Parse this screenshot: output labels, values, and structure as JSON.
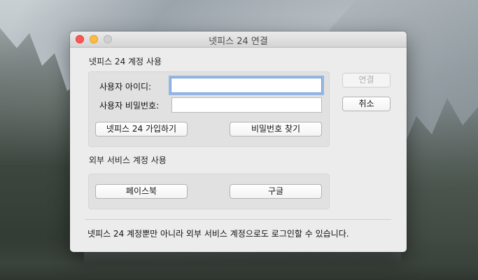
{
  "window": {
    "title": "넷피스 24 연결"
  },
  "netffice": {
    "section_label": "넷피스 24 계정 사용",
    "username_label": "사용자 아이디:",
    "username_value": "",
    "password_label": "사용자 비밀번호:",
    "password_value": "",
    "signup_button": "넷피스 24 가입하기",
    "find_password_button": "비밀번호 찾기"
  },
  "actions": {
    "connect_button": "연결",
    "cancel_button": "취소"
  },
  "external": {
    "section_label": "외부 서비스 계정 사용",
    "facebook_button": "페이스북",
    "google_button": "구글"
  },
  "footer": {
    "note": "넷피스 24 계정뿐만 아니라 외부 서비스 계정으로도 로그인할 수 있습니다."
  },
  "colors": {
    "close": "#fc5753",
    "minimize": "#fdbc40",
    "zoom": "#d0d0d0",
    "focus_ring": "#5c96e6"
  }
}
